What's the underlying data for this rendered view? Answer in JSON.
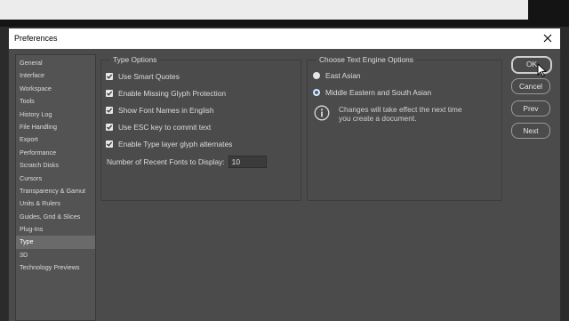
{
  "dialog": {
    "title": "Preferences"
  },
  "sidebar": {
    "items": [
      {
        "label": "General"
      },
      {
        "label": "Interface"
      },
      {
        "label": "Workspace"
      },
      {
        "label": "Tools"
      },
      {
        "label": "History Log"
      },
      {
        "label": "File Handling"
      },
      {
        "label": "Export"
      },
      {
        "label": "Performance"
      },
      {
        "label": "Scratch Disks"
      },
      {
        "label": "Cursors"
      },
      {
        "label": "Transparency & Gamut"
      },
      {
        "label": "Units & Rulers"
      },
      {
        "label": "Guides, Grid & Slices"
      },
      {
        "label": "Plug-Ins"
      },
      {
        "label": "Type"
      },
      {
        "label": "3D"
      },
      {
        "label": "Technology Previews"
      }
    ],
    "selected": "Type"
  },
  "type_options": {
    "legend": "Type Options",
    "checkboxes": [
      {
        "label": "Use Smart Quotes",
        "checked": true
      },
      {
        "label": "Enable Missing Glyph Protection",
        "checked": true
      },
      {
        "label": "Show Font Names in English",
        "checked": true
      },
      {
        "label": "Use ESC key to commit text",
        "checked": true
      },
      {
        "label": "Enable Type layer glyph alternates",
        "checked": true
      }
    ],
    "recent_fonts_label": "Number of Recent Fonts to Display:",
    "recent_fonts_value": "10"
  },
  "engine_options": {
    "legend": "Choose Text Engine Options",
    "radios": [
      {
        "label": "East Asian",
        "selected": false
      },
      {
        "label": "Middle Eastern and South Asian",
        "selected": true
      }
    ],
    "info_line1": "Changes will take effect the next time",
    "info_line2": "you create a document."
  },
  "buttons": {
    "ok": "OK",
    "cancel": "Cancel",
    "prev": "Prev",
    "next": "Next"
  },
  "colors": {
    "dialog_bg": "#4b4b4b",
    "sidebar_bg": "#535353",
    "selected_item": "#6a6a6a",
    "radio_accent": "#2a64c8"
  }
}
